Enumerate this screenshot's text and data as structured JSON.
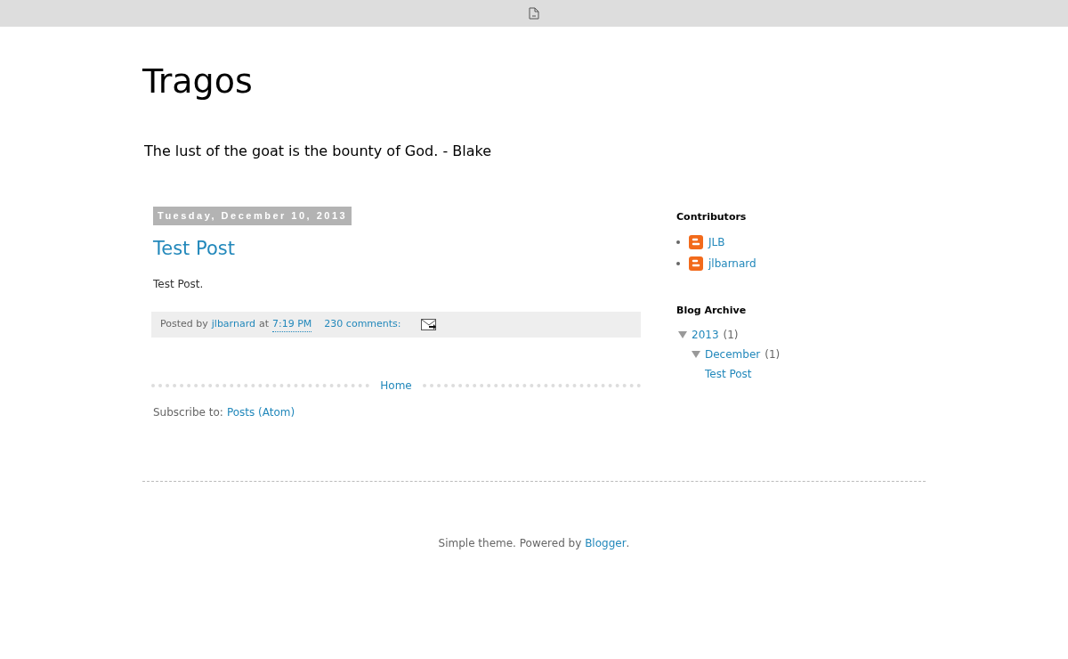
{
  "blog": {
    "title": "Tragos",
    "description": "The lust of the goat is the bounty of God. - Blake"
  },
  "post": {
    "date": "Tuesday, December 10, 2013",
    "title": "Test Post",
    "body": "Test Post.",
    "posted_by": "Posted by",
    "author": "jlbarnard",
    "at": "at",
    "time": "7:19 PM",
    "comments": "230 comments:"
  },
  "home_link": "Home",
  "subscribe": {
    "label": "Subscribe to:",
    "link": "Posts (Atom)"
  },
  "sidebar": {
    "contributors": {
      "title": "Contributors",
      "items": [
        "JLB",
        "jlbarnard"
      ]
    },
    "archive": {
      "title": "Blog Archive",
      "items": [
        {
          "label": "2013",
          "count": "(1)",
          "expanded": true,
          "children": [
            {
              "label": "December",
              "count": "(1)",
              "expanded": true,
              "children": [
                {
                  "label": "Test Post"
                }
              ]
            }
          ]
        }
      ]
    }
  },
  "footer": {
    "text": "Simple theme. Powered by",
    "link": "Blogger",
    "end": "."
  }
}
